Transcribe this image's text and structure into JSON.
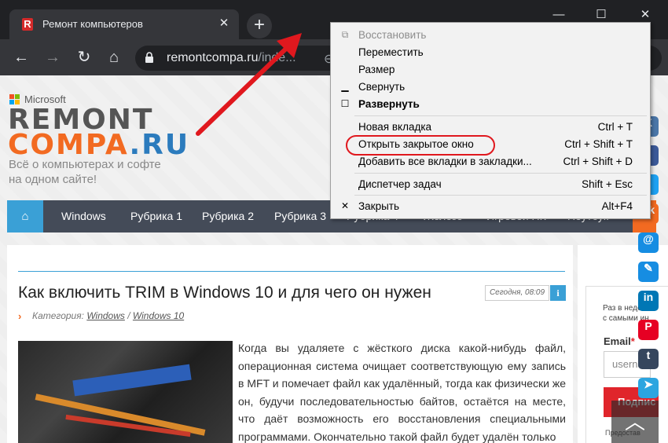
{
  "browser": {
    "tab_title": "Ремонт компьютеров",
    "tab_favicon": "R",
    "url_host": "remontcompa.ru",
    "url_rest": "/inde..."
  },
  "site": {
    "ms_label": "Microsoft",
    "brand_line1": "REMONT",
    "brand_line2_main": "COMPA",
    "brand_line2_tld": ".RU",
    "tagline_1": "Всё о компьютерах и софте",
    "tagline_2": "на одном сайте!",
    "nav": [
      "Windows",
      "Рубрика 1",
      "Рубрика 2",
      "Рубрика 3",
      "Рубрика 4",
      "Железо",
      "Игровой ПК",
      "Ноутбук"
    ]
  },
  "article": {
    "title": "Как включить TRIM в Windows 10 и для чего он нужен",
    "date": "Сегодня, 08:09",
    "info": "i",
    "category_label": "Категория:",
    "category_1": "Windows",
    "category_sep": "/",
    "category_2": "Windows 10",
    "body": "Когда вы удаляете с жёсткого диска какой-нибудь файл, операционная система очищает соответствующую ему запись в MFT и помечает файл как удалённый, тогда как физически же он, будучи последовательностью байтов, остаётся на месте, что даёт возможность его восстановления специальными программами. Окончательно такой файл будет удалён только"
  },
  "sidebar": {
    "text_1": "Раз в неде",
    "text_2": "с самыми ин",
    "email_label": "Email",
    "email_star": "*",
    "email_placeholder": "username",
    "submit": "Подпис",
    "note": "Предостав"
  },
  "context_menu": {
    "items": [
      {
        "label": "Восстановить",
        "shortcut": ""
      },
      {
        "label": "Переместить",
        "shortcut": ""
      },
      {
        "label": "Размер",
        "shortcut": ""
      },
      {
        "label": "Свернуть",
        "shortcut": ""
      },
      {
        "label": "Развернуть",
        "shortcut": ""
      },
      {
        "label": "Новая вкладка",
        "shortcut": "Ctrl + T"
      },
      {
        "label": "Открыть закрытое окно",
        "shortcut": "Ctrl + Shift + T"
      },
      {
        "label": "Добавить все вкладки в закладки...",
        "shortcut": "Ctrl + Shift + D"
      },
      {
        "label": "Диспетчер задач",
        "shortcut": "Shift + Esc"
      },
      {
        "label": "Закрыть",
        "shortcut": "Alt+F4"
      }
    ]
  },
  "colors": {
    "accent_orange": "#f26a21",
    "accent_blue": "#3aa0d6",
    "annotation_red": "#e0181e"
  }
}
